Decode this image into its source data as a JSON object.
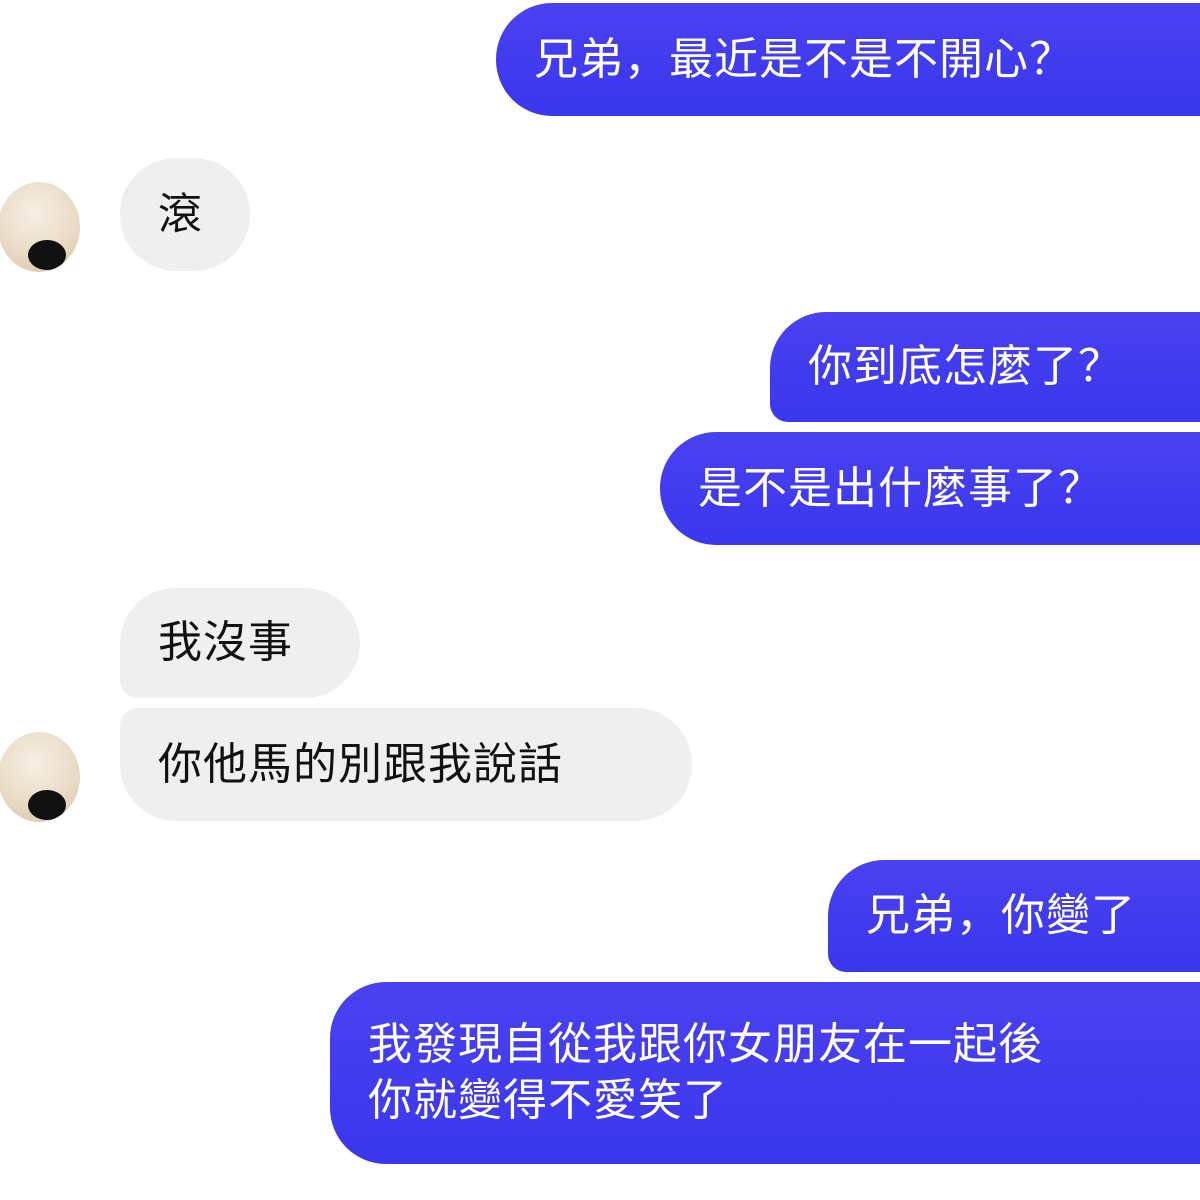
{
  "conversation": {
    "messages": [
      {
        "side": "outgoing",
        "text": "兄弟，最近是不是不開心？"
      },
      {
        "side": "incoming",
        "text": "滾"
      },
      {
        "side": "outgoing",
        "text": "你到底怎麼了？"
      },
      {
        "side": "outgoing",
        "text": "是不是出什麼事了？"
      },
      {
        "side": "incoming",
        "text": "我沒事"
      },
      {
        "side": "incoming",
        "text": "你他馬的別跟我說話"
      },
      {
        "side": "outgoing",
        "text": "兄弟，你變了"
      },
      {
        "side": "outgoing",
        "lines": [
          "我發現自從我跟你女朋友在一起後",
          "你就變得不愛笑了"
        ]
      }
    ]
  },
  "colors": {
    "outgoing_bubble": "#3d3aef",
    "incoming_bubble": "#efefef",
    "outgoing_text": "#ffffff",
    "incoming_text": "#111111"
  },
  "icons": {
    "avatar": "contact-avatar-icon"
  }
}
